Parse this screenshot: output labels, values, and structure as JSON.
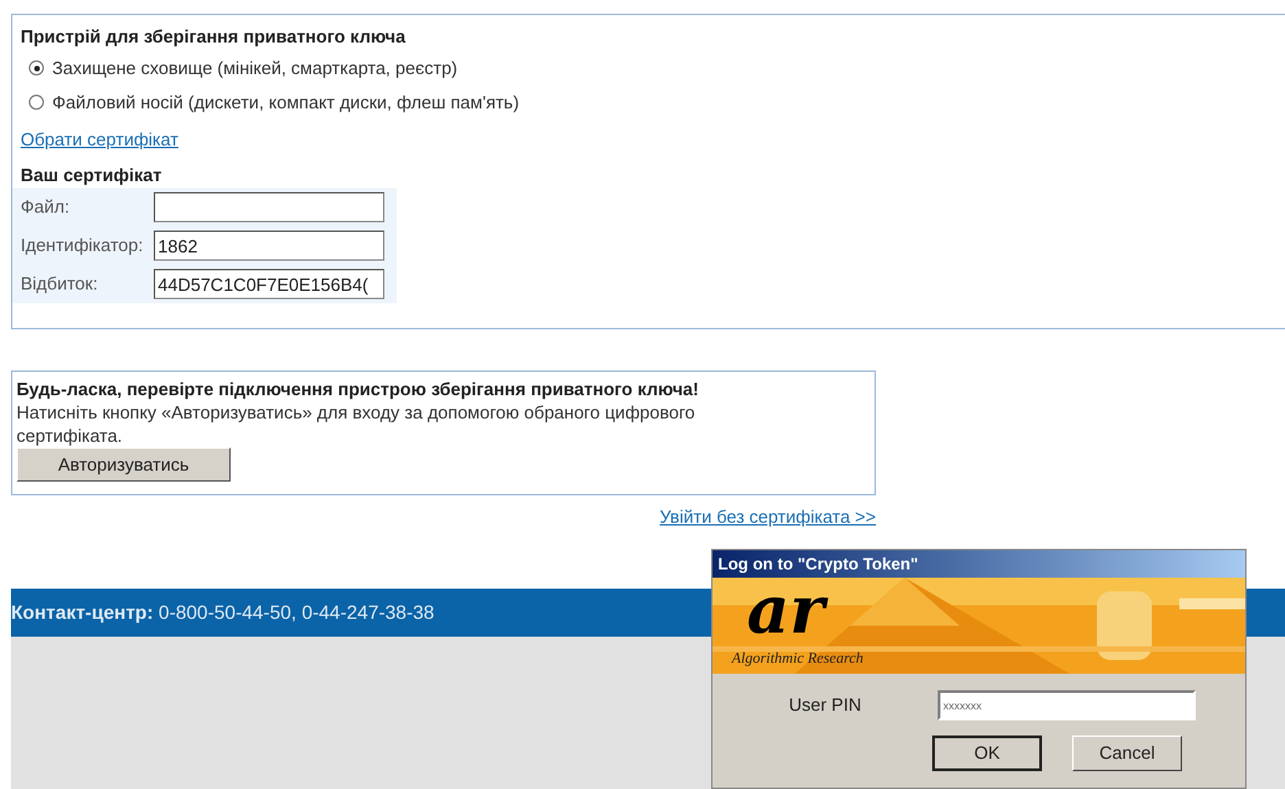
{
  "storage_panel": {
    "title": "Пристрій для зберігання приватного ключа",
    "options": [
      {
        "label": "Захищене сховище (мінікей, смарткарта, реєстр)",
        "selected": true
      },
      {
        "label": "Файловий носій (дискети, компакт диски, флеш пам'ять)",
        "selected": false
      }
    ],
    "choose_link": "Обрати сертифікат",
    "certificate_title": "Ваш сертифікат",
    "fields": [
      {
        "label": "Файл:"
      },
      {
        "label": "Ідентифікатор:",
        "value": "1862"
      },
      {
        "label": "Відбиток:",
        "value": "44D57C1C0F7E0E156B4("
      }
    ]
  },
  "message_panel": {
    "title": "Будь-ласка, перевірте підключення пристрою зберігання приватного ключа!",
    "text": "Натисніть кнопку «Авторизуватись» для входу за допомогою обраного цифрового сертифіката.",
    "button": "Авторизуватись"
  },
  "no_cert_link": "Увійти без сертифіката >>",
  "footer": {
    "text": "**Контакт-центр:** 0-800-50-44-50, 0-44-247-38-38"
  },
  "dialog": {
    "title": "Log on to \"Crypto Token\"",
    "logo": "ar",
    "logo_caption": "Algorithmic Research",
    "pin_label": "User PIN",
    "pin_value": "xxxxxxx",
    "buttons": [
      "OK",
      "Cancel"
    ]
  }
}
